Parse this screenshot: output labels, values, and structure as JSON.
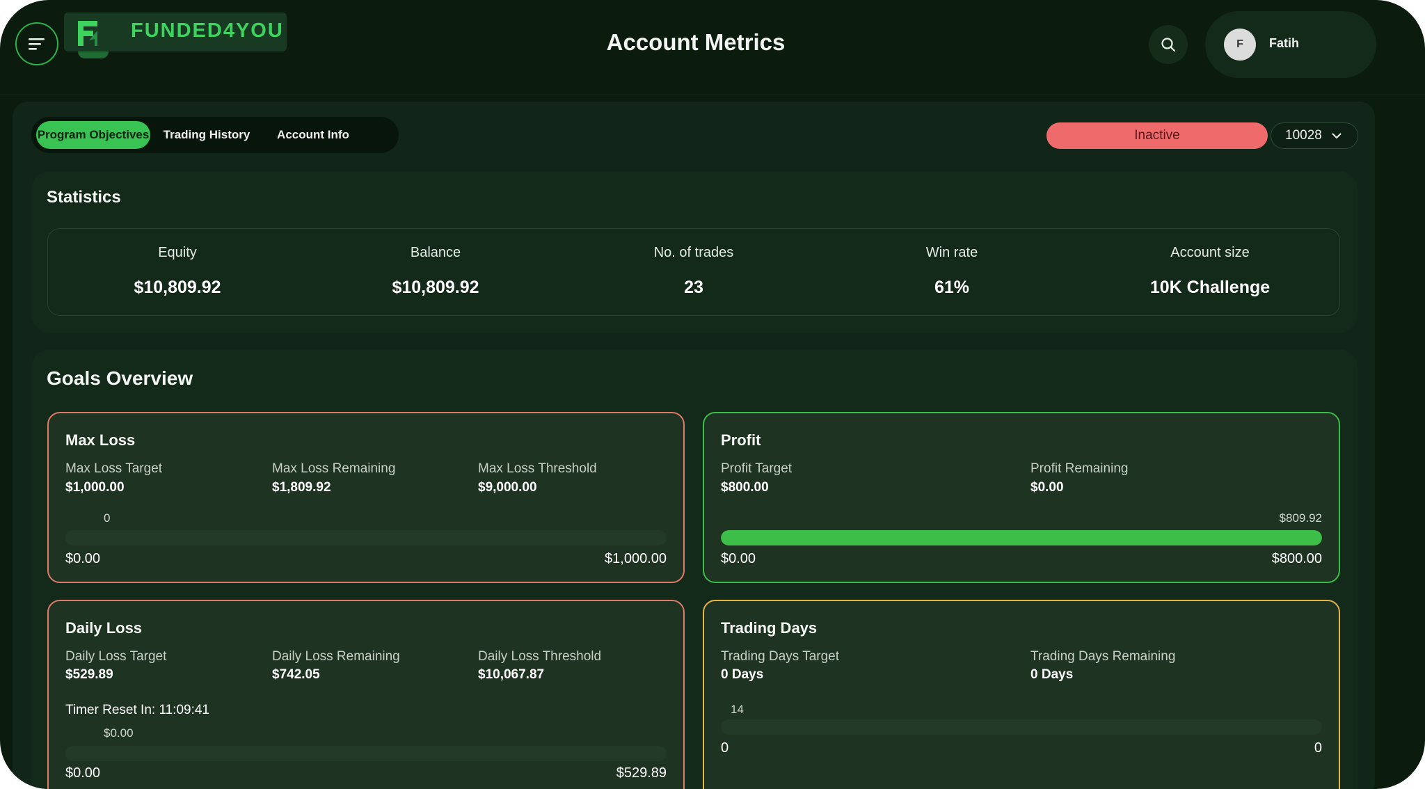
{
  "app": {
    "brand": "FUNDED4YOU",
    "page_title": "Account Metrics"
  },
  "user": {
    "initial": "F",
    "name": "Fatih"
  },
  "icons": {
    "menu": "menu-lines-icon",
    "search": "search-icon",
    "chevron": "chevron-down-icon",
    "logo": "funded4you-logo-icon"
  },
  "colors": {
    "accent": "#39c352",
    "danger": "#ef6b6b",
    "warning": "#e6b445",
    "background": "#0b1c0f"
  },
  "tabs": [
    {
      "label": "Program Objectives",
      "active": true
    },
    {
      "label": "Trading History",
      "active": false
    },
    {
      "label": "Account Info",
      "active": false
    }
  ],
  "status": "Inactive",
  "account_number": "10028",
  "statistics": {
    "title": "Statistics",
    "items": [
      {
        "label": "Equity",
        "value": "$10,809.92"
      },
      {
        "label": "Balance",
        "value": "$10,809.92"
      },
      {
        "label": "No. of trades",
        "value": "23"
      },
      {
        "label": "Win rate",
        "value": "61%"
      },
      {
        "label": "Account size",
        "value": "10K Challenge"
      }
    ]
  },
  "goals": {
    "title": "Goals Overview",
    "max_loss": {
      "title": "Max Loss",
      "target_label": "Max Loss Target",
      "target_value": "$1,000.00",
      "remaining_label": "Max Loss Remaining",
      "remaining_value": "$1,809.92",
      "threshold_label": "Max Loss Threshold",
      "threshold_value": "$9,000.00",
      "bar_marker": "0",
      "bar_start": "$0.00",
      "bar_end": "$1,000.00",
      "progress": 0
    },
    "profit": {
      "title": "Profit",
      "target_label": "Profit Target",
      "target_value": "$800.00",
      "remaining_label": "Profit Remaining",
      "remaining_value": "$0.00",
      "bar_marker": "$809.92",
      "bar_start": "$0.00",
      "bar_end": "$800.00",
      "progress": 1.0
    },
    "daily_loss": {
      "title": "Daily Loss",
      "target_label": "Daily Loss Target",
      "target_value": "$529.89",
      "remaining_label": "Daily Loss Remaining",
      "remaining_value": "$742.05",
      "threshold_label": "Daily Loss Threshold",
      "threshold_value": "$10,067.87",
      "timer": "Timer Reset In: 11:09:41",
      "bar_marker": "$0.00",
      "bar_start": "$0.00",
      "bar_end": "$529.89",
      "progress": 0
    },
    "trading_days": {
      "title": "Trading Days",
      "target_label": "Trading Days Target",
      "target_value": "0 Days",
      "remaining_label": "Trading Days Remaining",
      "remaining_value": "0 Days",
      "bar_marker": "14",
      "bar_start": "0",
      "bar_end": "0",
      "progress": 0
    }
  }
}
